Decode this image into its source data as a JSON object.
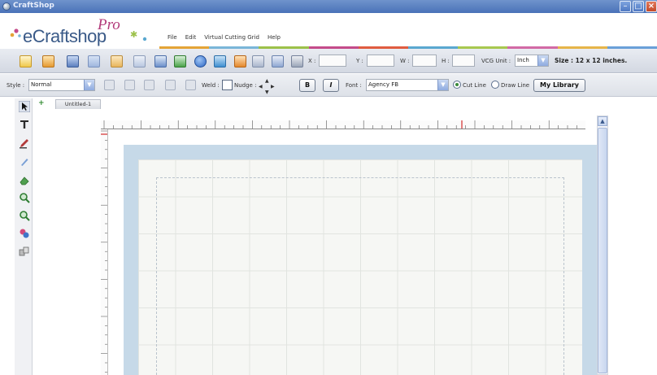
{
  "window": {
    "title": "CraftShop"
  },
  "logo": {
    "name": "eCraftshop",
    "edition": "Pro"
  },
  "menu": {
    "items": [
      "File",
      "Edit",
      "Virtual Cutting Grid",
      "Help"
    ]
  },
  "toolbar": {
    "coords": {
      "x_label": "X :",
      "y_label": "Y :",
      "w_label": "W :",
      "h_label": "H :",
      "x": "",
      "y": "",
      "w": "",
      "h": ""
    },
    "vcg_unit_label": "VCG Unit :",
    "vcg_unit_value": "Inch",
    "size_label": "Size : 12 x 12 inches."
  },
  "formatbar": {
    "style_label": "Style :",
    "style_value": "Normal",
    "weld_label": "Weld :",
    "nudge_label": "Nudge :",
    "bold_label": "B",
    "italic_label": "I",
    "font_label": "Font :",
    "font_value": "Agency FB",
    "cut_line_label": "Cut Line",
    "draw_line_label": "Draw Line",
    "library_button": "My Library"
  },
  "document": {
    "tab_name": "Untitled-1",
    "add_tab_symbol": "+"
  },
  "colors": {
    "titlebar": "#4a72b8",
    "mat": "#c6d9e8",
    "sheet": "#f6f7f4",
    "ruler_marker": "#d94a4a"
  },
  "stripe_colors": [
    "#e4a437",
    "#7ab6d8",
    "#9cc14a",
    "#c44b8a",
    "#e05c40",
    "#5aa8d0",
    "#a8c84f",
    "#d26aa5",
    "#e6b54a",
    "#6aa0d8"
  ]
}
